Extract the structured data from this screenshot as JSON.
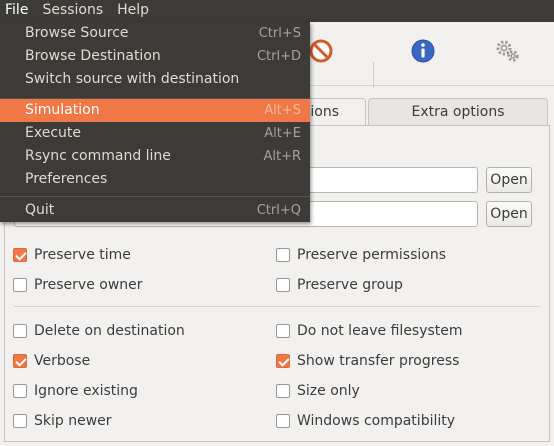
{
  "menubar": {
    "file": "File",
    "sessions": "Sessions",
    "help": "Help"
  },
  "toolbar": {
    "icons": [
      "stop-icon",
      "info-icon",
      "gears-icon"
    ]
  },
  "tabs": {
    "options_partial": "ptions",
    "extra_options": "Extra options"
  },
  "paths": {
    "open_label_1": "Open",
    "open_label_2": "Open"
  },
  "options": {
    "preserve_time": {
      "label": "Preserve time",
      "checked": true
    },
    "preserve_permissions": {
      "label": "Preserve permissions",
      "checked": false
    },
    "preserve_owner": {
      "label": "Preserve owner",
      "checked": false
    },
    "preserve_group": {
      "label": "Preserve group",
      "checked": false
    },
    "delete_on_destination": {
      "label": "Delete on destination",
      "checked": false
    },
    "do_not_leave_filesystem": {
      "label": "Do not leave filesystem",
      "checked": false
    },
    "verbose": {
      "label": "Verbose",
      "checked": true
    },
    "show_transfer_progress": {
      "label": "Show transfer progress",
      "checked": true
    },
    "ignore_existing": {
      "label": "Ignore existing",
      "checked": false
    },
    "size_only": {
      "label": "Size only",
      "checked": false
    },
    "skip_newer": {
      "label": "Skip newer",
      "checked": false
    },
    "windows_compatibility": {
      "label": "Windows compatibility",
      "checked": false
    }
  },
  "file_menu": {
    "browse_source": {
      "label": "Browse Source",
      "accel": "Ctrl+S"
    },
    "browse_destination": {
      "label": "Browse Destination",
      "accel": "Ctrl+D"
    },
    "switch": {
      "label": "Switch source with destination",
      "accel": ""
    },
    "simulation": {
      "label": "Simulation",
      "accel": "Alt+S"
    },
    "execute": {
      "label": "Execute",
      "accel": "Alt+E"
    },
    "rsync_cmd": {
      "label": "Rsync command line",
      "accel": "Alt+R"
    },
    "preferences": {
      "label": "Preferences",
      "accel": ""
    },
    "quit": {
      "label": "Quit",
      "accel": "Ctrl+Q"
    }
  },
  "colors": {
    "accent": "#f07746",
    "menu_bg": "#3c3b37",
    "window_bg": "#f2f1f0"
  }
}
